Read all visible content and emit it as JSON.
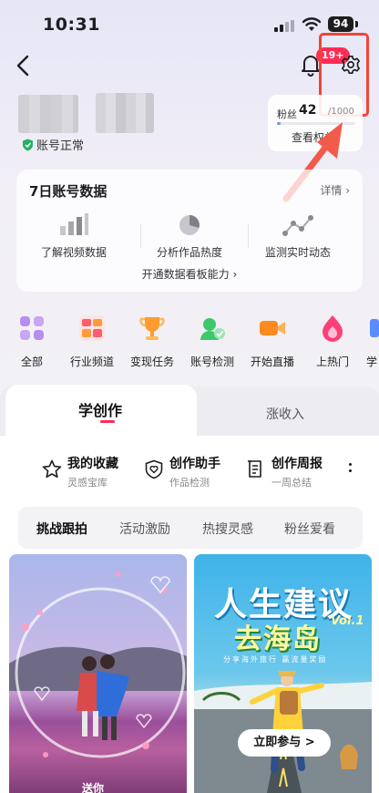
{
  "status_bar": {
    "time": "10:31",
    "battery": "94"
  },
  "header": {
    "notification_badge": "19+"
  },
  "profile": {
    "account_status": "账号正常"
  },
  "fans": {
    "label": "粉丝",
    "count": "42",
    "goal": "/1000",
    "link": "查看权益",
    "progress_fraction": 0.042
  },
  "data_card": {
    "title": "7日账号数据",
    "detail": "详情",
    "stats": [
      {
        "label": "了解视频数据",
        "icon": "bar-chart-icon"
      },
      {
        "label": "分析作品热度",
        "icon": "pie-chart-icon"
      },
      {
        "label": "监测实时动态",
        "icon": "line-chart-icon"
      }
    ],
    "open_text": "开通数据看板能力"
  },
  "shortcuts": [
    {
      "label": "全部",
      "icon": "grid-icon"
    },
    {
      "label": "行业频道",
      "icon": "channel-icon"
    },
    {
      "label": "变现任务",
      "icon": "trophy-icon"
    },
    {
      "label": "账号检测",
      "icon": "check-icon"
    },
    {
      "label": "开始直播",
      "icon": "camera-icon"
    },
    {
      "label": "上热门",
      "icon": "flame-icon"
    },
    {
      "label": "学",
      "icon": "learn-icon"
    }
  ],
  "tabs": {
    "learn": "学创作",
    "income": "涨收入"
  },
  "tools": [
    {
      "title": "我的收藏",
      "subtitle": "灵感宝库",
      "icon": "star-icon"
    },
    {
      "title": "创作助手",
      "subtitle": "作品检测",
      "icon": "shield-heart-icon"
    },
    {
      "title": "创作周报",
      "subtitle": "一周总结",
      "icon": "report-icon"
    }
  ],
  "sub_tabs": [
    "挑战跟拍",
    "活动激励",
    "热搜灵感",
    "粉丝爱看"
  ],
  "cards": {
    "right_title_1": "人生建议",
    "right_title_2": "去海岛",
    "right_vol": "Vol.1",
    "right_subtitle": "分享海外旅行 赢流量奖励",
    "join_button": "立即参与 >",
    "left_caption": "送你"
  },
  "colors": {
    "accent": "#fe2c55",
    "highlight": "#f44336"
  }
}
